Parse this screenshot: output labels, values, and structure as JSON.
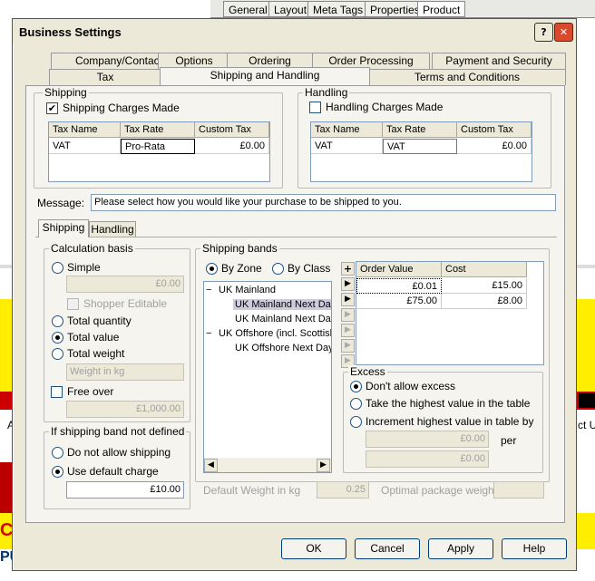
{
  "background_tabs": [
    "General",
    "Layout",
    "Meta Tags",
    "Properties",
    "Product"
  ],
  "background_fragments": {
    "left_letters": "A",
    "right_text": "ct U",
    "red_text": "CC",
    "blue_text": "PU"
  },
  "window": {
    "title": "Business Settings",
    "help_label": "?",
    "close_label": "✕"
  },
  "tabs_row1": [
    "Company/Contact",
    "Options",
    "Ordering",
    "Order Processing",
    "Payment and Security"
  ],
  "tabs_row2": [
    "Tax",
    "Shipping and Handling",
    "Terms and Conditions"
  ],
  "shipping": {
    "label": "Shipping",
    "charges_label": "Shipping Charges Made",
    "charges_checked": true,
    "headers": [
      "Tax Name",
      "Tax Rate",
      "Custom Tax"
    ],
    "row": [
      "VAT",
      "Pro-Rata",
      "£0.00"
    ]
  },
  "handling": {
    "label": "Handling",
    "charges_label": "Handling Charges Made",
    "charges_checked": false,
    "headers": [
      "Tax Name",
      "Tax Rate",
      "Custom Tax"
    ],
    "row": [
      "VAT",
      "VAT",
      "£0.00"
    ]
  },
  "message": {
    "label": "Message:",
    "value": "Please select how you would like your purchase to be shipped to you."
  },
  "subtabs": [
    "Shipping",
    "Handling"
  ],
  "calc": {
    "label": "Calculation basis",
    "simple": "Simple",
    "simple_value": "£0.00",
    "shopper_editable": "Shopper Editable",
    "total_quantity": "Total quantity",
    "total_value": "Total value",
    "total_weight": "Total weight",
    "weight_placeholder": "Weight in kg",
    "free_over": "Free over",
    "free_over_value": "£1,000.00"
  },
  "undefined_band": {
    "label": "If shipping band not defined",
    "not_allow": "Do not allow shipping",
    "use_default": "Use default charge",
    "default_value": "£10.00"
  },
  "bands": {
    "label": "Shipping bands",
    "by_zone": "By Zone",
    "by_class": "By Class",
    "tree": [
      {
        "text": "UK Mainland",
        "sign": "−"
      },
      {
        "text": "UK Mainland Next Day"
      },
      {
        "text": "UK Mainland Next Day"
      },
      {
        "text": "UK Offshore (incl. Scottish",
        "sign": "−"
      },
      {
        "text": "UK Offshore Next Day"
      }
    ],
    "add_label": "+",
    "headers": [
      "Order Value",
      "Cost"
    ],
    "rows": [
      [
        "£0.01",
        "£15.00"
      ],
      [
        "£75.00",
        "£8.00"
      ]
    ]
  },
  "excess": {
    "label": "Excess",
    "dont_allow": "Don't allow excess",
    "take_highest": "Take the highest value in the table",
    "increment": "Increment highest value in table by",
    "amount": "£0.00",
    "per": "per",
    "per_value": "£0.00"
  },
  "default_weight": {
    "label": "Default Weight in kg",
    "value": "0.25"
  },
  "optimal_package": {
    "label": "Optimal package weight",
    "value": ""
  },
  "buttons": {
    "ok": "OK",
    "cancel": "Cancel",
    "apply": "Apply",
    "help": "Help"
  }
}
